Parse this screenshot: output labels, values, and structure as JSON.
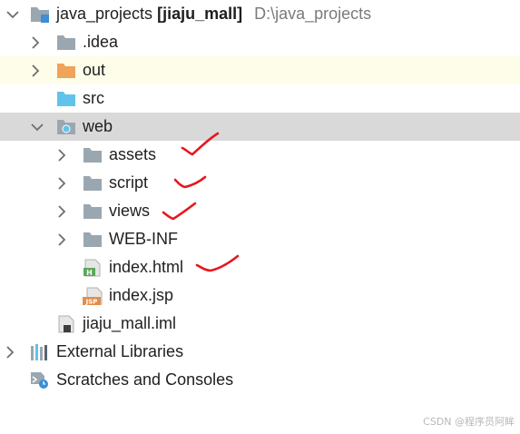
{
  "tree": {
    "root": {
      "name": "java_projects",
      "module": "[jiaju_mall]",
      "path": "D:\\java_projects"
    },
    "idea": {
      "name": ".idea"
    },
    "out": {
      "name": "out"
    },
    "src": {
      "name": "src"
    },
    "web": {
      "name": "web"
    },
    "assets": {
      "name": "assets"
    },
    "script": {
      "name": "script"
    },
    "views": {
      "name": "views"
    },
    "webinf": {
      "name": "WEB-INF"
    },
    "index_html": {
      "name": "index.html"
    },
    "index_jsp": {
      "name": "index.jsp"
    },
    "iml": {
      "name": "jiaju_mall.iml"
    },
    "ext_libs": {
      "name": "External Libraries"
    },
    "scratches": {
      "name": "Scratches and Consoles"
    }
  },
  "icons": {
    "folder": "folder-icon",
    "folder_orange": "excluded-folder-icon",
    "folder_blue": "source-folder-icon",
    "web_folder": "web-folder-icon",
    "html_file": "html-file-icon",
    "jsp_file": "jsp-file-icon",
    "iml_file": "module-file-icon",
    "libraries": "libraries-icon",
    "scratches": "scratches-icon"
  },
  "colors": {
    "folder_gray": "#9aa7b0",
    "folder_orange": "#f0a35b",
    "folder_blue": "#62c3ea",
    "selected_row": "#d9d9d9",
    "highlight_row": "#fdfde9",
    "annotation_red": "#e8141e"
  },
  "watermark": "CSDN @程序员阿眸"
}
